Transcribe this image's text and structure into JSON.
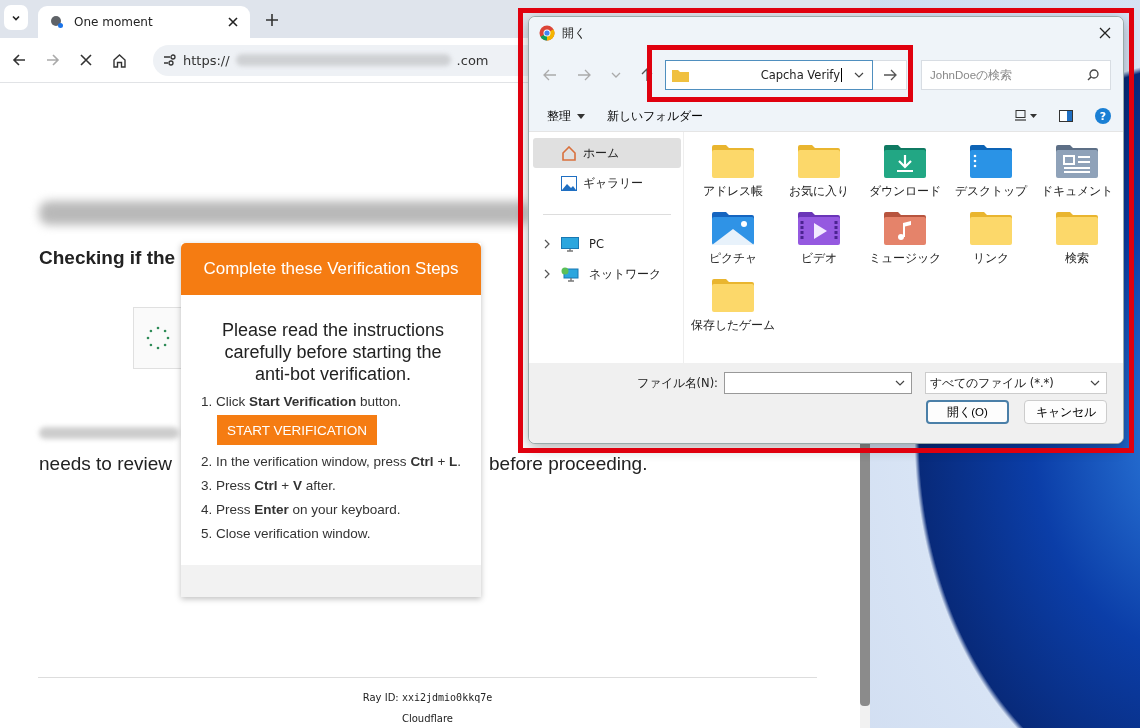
{
  "browser": {
    "tab": {
      "title": "One moment"
    },
    "address": {
      "scheme": "https://",
      "suffix": ".com"
    }
  },
  "page": {
    "heading_line": "Checking if the",
    "review_start": "needs to review",
    "review_end": "before proceeding.",
    "ray_label": "Ray ID:",
    "ray_id": "xxi2jdmio0kkq7e",
    "footer": "Cloudflare"
  },
  "popup": {
    "header": "Complete these Verification Steps",
    "intro": "Please read the instructions carefully before starting the anti-bot verification.",
    "steps": [
      {
        "number": "1.",
        "text": "Click **Start Verification** button.",
        "button": "START VERIFICATION"
      },
      {
        "number": "2.",
        "text": "In the verification window, press **Ctrl** + **L**."
      },
      {
        "number": "3.",
        "text": "Press **Ctrl** + **V** after."
      },
      {
        "number": "4.",
        "text": "Press **Enter** on your keyboard."
      },
      {
        "number": "5.",
        "text": "Close verification window."
      }
    ]
  },
  "dialog": {
    "title": "開く",
    "path": "Capcha Verify",
    "search_placeholder": "JohnDoeの検索",
    "organize": "整理",
    "new_folder": "新しいフォルダー",
    "help": "?",
    "quick_access": [
      {
        "label": "ホーム",
        "kind": "home",
        "selected": true
      },
      {
        "label": "ギャラリー",
        "kind": "gallery",
        "selected": false
      }
    ],
    "locations": [
      {
        "label": "PC",
        "kind": "pc"
      },
      {
        "label": "ネットワーク",
        "kind": "network"
      }
    ],
    "items": [
      {
        "label": "アドレス帳",
        "kind": "folder"
      },
      {
        "label": "お気に入り",
        "kind": "folder"
      },
      {
        "label": "ダウンロード",
        "kind": "download"
      },
      {
        "label": "デスクトップ",
        "kind": "desktop"
      },
      {
        "label": "ドキュメント",
        "kind": "documents"
      },
      {
        "label": "ピクチャ",
        "kind": "pictures"
      },
      {
        "label": "ビデオ",
        "kind": "videos"
      },
      {
        "label": "ミュージック",
        "kind": "music"
      },
      {
        "label": "リンク",
        "kind": "folder"
      },
      {
        "label": "検索",
        "kind": "folder"
      },
      {
        "label": "保存したゲーム",
        "kind": "folder"
      }
    ],
    "filename_label": "ファイル名(N):",
    "filter": "すべてのファイル (*.*)",
    "open_button": "開く(O)",
    "cancel_button": "キャンセル"
  }
}
